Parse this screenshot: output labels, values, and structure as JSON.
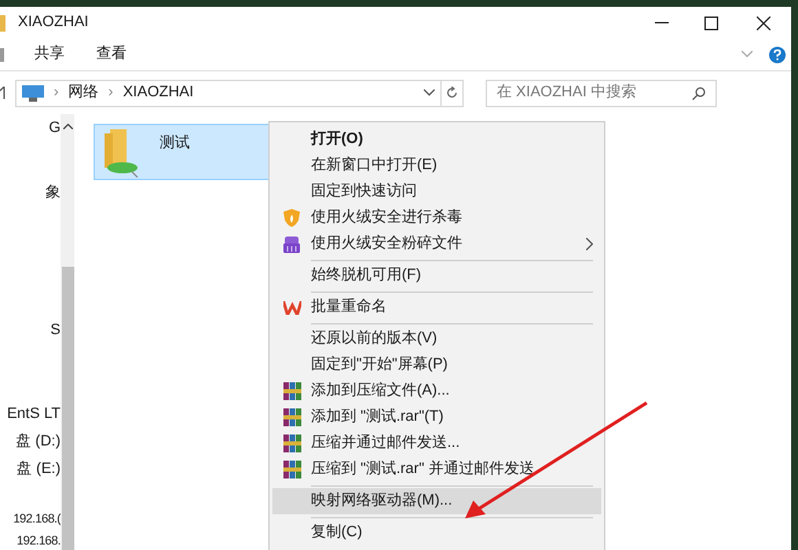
{
  "window": {
    "title": "XIAOZHAI"
  },
  "ribbon": {
    "tabs": [
      {
        "label": "共享",
        "selected": false
      },
      {
        "label": "查看",
        "selected": false
      }
    ]
  },
  "address_bar": {
    "path": [
      "网络",
      "XIAOZHAI"
    ],
    "separator": "›"
  },
  "search": {
    "placeholder": "在 XIAOZHAI 中搜索"
  },
  "nav_pane": {
    "items": [
      "G",
      "象",
      "S",
      "EntS LT",
      "盘 (D:)",
      "盘 (E:)",
      "192.168.(",
      "192.168."
    ]
  },
  "content": {
    "items": [
      {
        "label": "测试",
        "selected": true
      }
    ]
  },
  "context_menu": {
    "items": [
      {
        "kind": "plain",
        "label": "打开(O)",
        "default": true,
        "selected": false,
        "submenu": false
      },
      {
        "kind": "plain",
        "label": "在新窗口中打开(E)",
        "default": false,
        "selected": false,
        "submenu": false
      },
      {
        "kind": "plain",
        "label": "固定到快速访问",
        "default": false,
        "selected": false,
        "submenu": false
      },
      {
        "kind": "shield",
        "label": "使用火绒安全进行杀毒",
        "default": false,
        "selected": false,
        "submenu": false
      },
      {
        "kind": "shred",
        "label": "使用火绒安全粉碎文件",
        "default": false,
        "selected": false,
        "submenu": true
      },
      {
        "kind": "separator"
      },
      {
        "kind": "plain",
        "label": "始终脱机可用(F)",
        "default": false,
        "selected": false,
        "submenu": false
      },
      {
        "kind": "separator"
      },
      {
        "kind": "wps",
        "label": "批量重命名",
        "default": false,
        "selected": false,
        "submenu": false
      },
      {
        "kind": "separator"
      },
      {
        "kind": "plain",
        "label": "还原以前的版本(V)",
        "default": false,
        "selected": false,
        "submenu": false
      },
      {
        "kind": "plain",
        "label": "固定到\"开始\"屏幕(P)",
        "default": false,
        "selected": false,
        "submenu": false
      },
      {
        "kind": "rar",
        "label": "添加到压缩文件(A)...",
        "default": false,
        "selected": false,
        "submenu": false
      },
      {
        "kind": "rar",
        "label": "添加到 \"测试.rar\"(T)",
        "default": false,
        "selected": false,
        "submenu": false
      },
      {
        "kind": "rar",
        "label": "压缩并通过邮件发送...",
        "default": false,
        "selected": false,
        "submenu": false
      },
      {
        "kind": "rar",
        "label": "压缩到 \"测试.rar\" 并通过邮件发送",
        "default": false,
        "selected": false,
        "submenu": false
      },
      {
        "kind": "separator"
      },
      {
        "kind": "plain",
        "label": "映射网络驱动器(M)...",
        "default": false,
        "selected": true,
        "submenu": false
      },
      {
        "kind": "separator"
      },
      {
        "kind": "plain",
        "label": "复制(C)",
        "default": false,
        "selected": false,
        "submenu": false
      }
    ]
  }
}
